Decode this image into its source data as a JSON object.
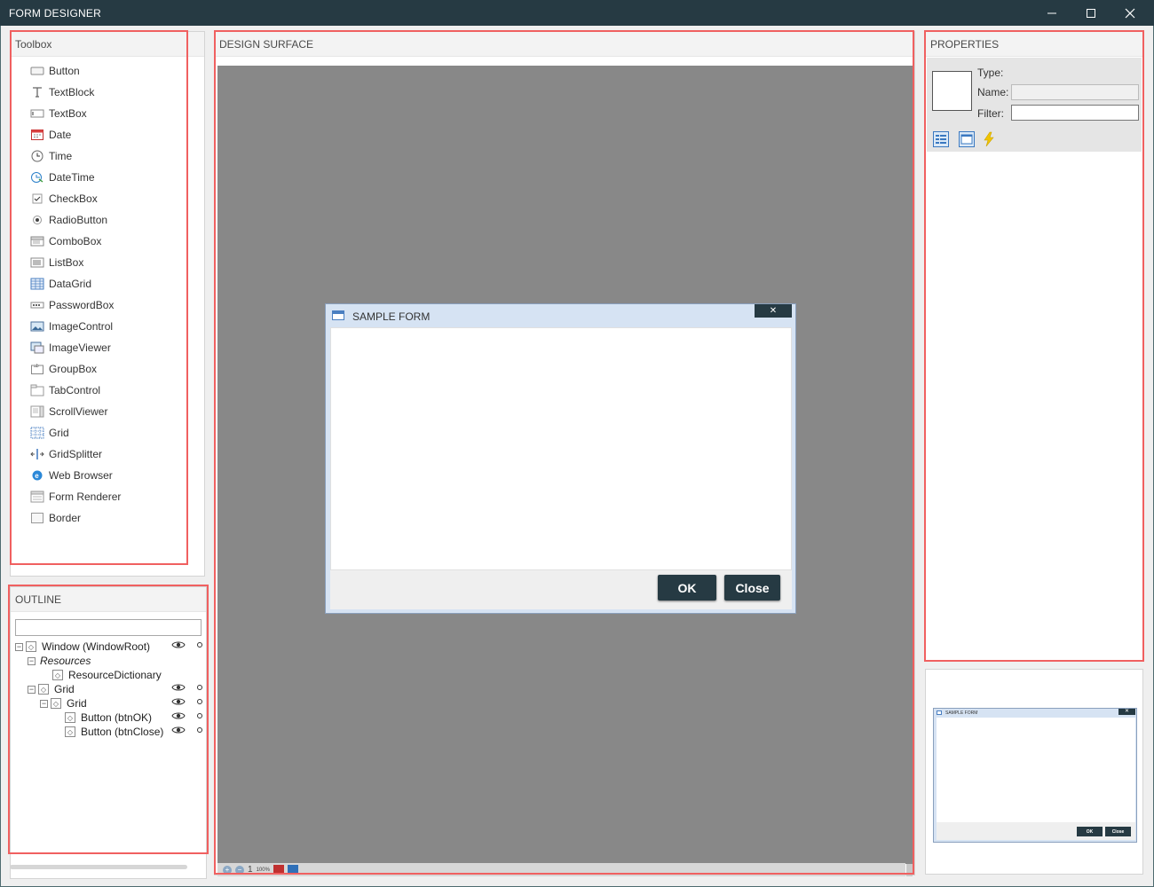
{
  "window": {
    "title": "FORM DESIGNER",
    "minimize_icon": "minimize-icon",
    "maximize_icon": "maximize-icon",
    "close_icon": "close-icon"
  },
  "toolbox": {
    "header": "Toolbox",
    "items": [
      {
        "label": "Button",
        "icon": "button-icon"
      },
      {
        "label": "TextBlock",
        "icon": "textblock-icon"
      },
      {
        "label": "TextBox",
        "icon": "textbox-icon"
      },
      {
        "label": "Date",
        "icon": "calendar-icon"
      },
      {
        "label": "Time",
        "icon": "clock-icon"
      },
      {
        "label": "DateTime",
        "icon": "datetime-icon"
      },
      {
        "label": "CheckBox",
        "icon": "checkbox-icon"
      },
      {
        "label": "RadioButton",
        "icon": "radio-icon"
      },
      {
        "label": "ComboBox",
        "icon": "combobox-icon"
      },
      {
        "label": "ListBox",
        "icon": "listbox-icon"
      },
      {
        "label": "DataGrid",
        "icon": "datagrid-icon"
      },
      {
        "label": "PasswordBox",
        "icon": "passwordbox-icon"
      },
      {
        "label": "ImageControl",
        "icon": "image-icon"
      },
      {
        "label": "ImageViewer",
        "icon": "imageviewer-icon"
      },
      {
        "label": "GroupBox",
        "icon": "groupbox-icon"
      },
      {
        "label": "TabControl",
        "icon": "tabcontrol-icon"
      },
      {
        "label": "ScrollViewer",
        "icon": "scrollviewer-icon"
      },
      {
        "label": "Grid",
        "icon": "grid-icon"
      },
      {
        "label": "GridSplitter",
        "icon": "gridsplitter-icon"
      },
      {
        "label": "Web Browser",
        "icon": "web-browser-icon"
      },
      {
        "label": "Form Renderer",
        "icon": "form-renderer-icon"
      },
      {
        "label": "Border",
        "icon": "border-icon"
      }
    ]
  },
  "outline": {
    "header": "OUTLINE",
    "search_value": "",
    "nodes": [
      {
        "label": "Window (WindowRoot)",
        "expander": "⊟",
        "visible": true
      },
      {
        "label": "Resources",
        "expander": "⊟",
        "italic": true
      },
      {
        "label": "ResourceDictionary"
      },
      {
        "label": "Grid",
        "expander": "⊟",
        "visible": true
      },
      {
        "label": "Grid",
        "expander": "⊟",
        "visible": true
      },
      {
        "label": "Button (btnOK)",
        "visible": true
      },
      {
        "label": "Button (btnClose)",
        "visible": true
      }
    ]
  },
  "design": {
    "header": "DESIGN SURFACE",
    "zoom_value": "1",
    "zoom_percent": "100%",
    "form": {
      "title": "SAMPLE FORM",
      "close_glyph": "✕",
      "ok_label": "OK",
      "close_label": "Close"
    }
  },
  "properties": {
    "header": "PROPERTIES",
    "type_label": "Type:",
    "name_label": "Name:",
    "filter_label": "Filter:",
    "name_value": "",
    "filter_value": "",
    "buttons": [
      "categorized-icon",
      "properties-icon",
      "events-lightning-icon"
    ]
  },
  "preview": {
    "title": "SAMPLE FORM",
    "ok_label": "OK",
    "close_label": "Close"
  }
}
